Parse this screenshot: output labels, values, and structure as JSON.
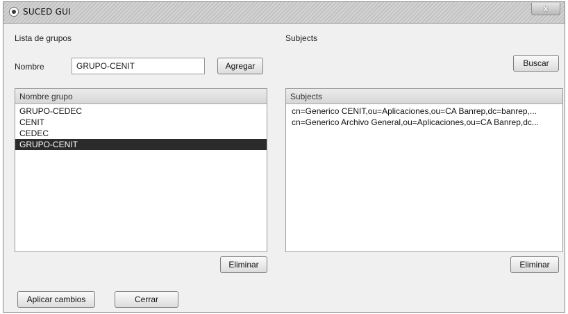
{
  "window": {
    "title": "SUCED GUI",
    "close_glyph": "x"
  },
  "left": {
    "section_label": "Lista de grupos",
    "name_label": "Nombre",
    "name_value": "GRUPO-CENIT",
    "add_button": "Agregar",
    "list_header": "Nombre grupo",
    "groups": [
      "GRUPO-CEDEC",
      "CENIT",
      "CEDEC",
      "GRUPO-CENIT"
    ],
    "selected_index": 3,
    "delete_button": "Eliminar"
  },
  "right": {
    "section_label": "Subjects",
    "search_button": "Buscar",
    "list_header": "Subjects",
    "subjects": [
      "cn=Generico CENIT,ou=Aplicaciones,ou=CA Banrep,dc=banrep,...",
      "cn=Generico Archivo General,ou=Aplicaciones,ou=CA Banrep,dc..."
    ],
    "delete_button": "Eliminar"
  },
  "footer": {
    "apply_button": "Aplicar cambios",
    "close_button": "Cerrar"
  },
  "icons": {
    "app": "app-icon",
    "close": "close-icon"
  }
}
